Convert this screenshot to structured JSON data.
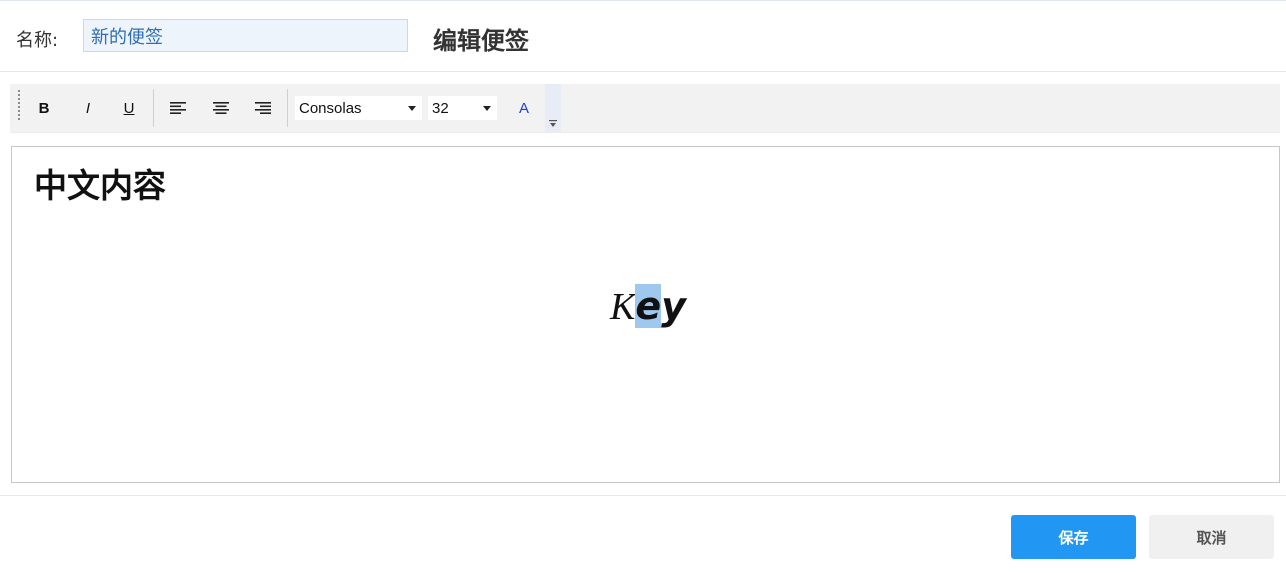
{
  "header": {
    "name_label": "名称:",
    "name_value": "新的便签",
    "page_title": "编辑便签"
  },
  "toolbar": {
    "bold_label": "B",
    "italic_label": "I",
    "underline_label": "U",
    "align_left_icon": "align-left-icon",
    "align_center_icon": "align-center-icon",
    "align_right_icon": "align-right-icon",
    "font_family": "Consolas",
    "font_size": "32",
    "font_color_label": "A",
    "font_color": "#1a3fd6",
    "overflow_icon": "chevron-down-icon"
  },
  "editor": {
    "heading": "中文内容",
    "key_chars": [
      "K",
      "e",
      "y"
    ],
    "selection_color": "#9ec8ee"
  },
  "footer": {
    "save_label": "保存",
    "cancel_label": "取消",
    "save_color": "#2196f3"
  }
}
